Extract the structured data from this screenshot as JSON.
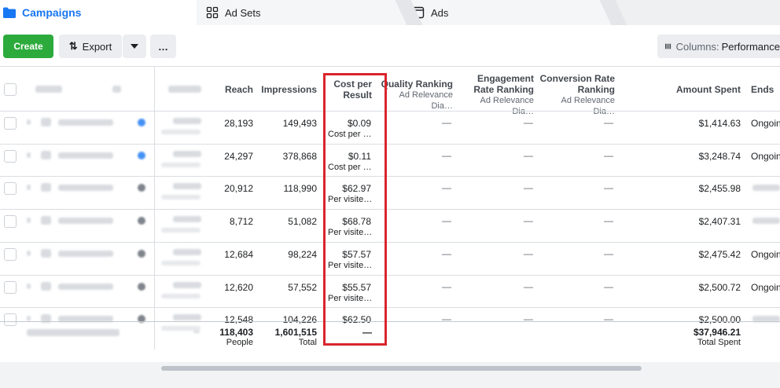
{
  "tabs": [
    {
      "label": "Campaigns",
      "icon": "folder-icon"
    },
    {
      "label": "Ad Sets",
      "icon": "grid-icon"
    },
    {
      "label": "Ads",
      "icon": "window-icon"
    }
  ],
  "toolbar": {
    "create_label": "Create",
    "export_label": "Export",
    "more_label": "…",
    "columns_label": "Columns:",
    "columns_value": "Performance"
  },
  "columns": {
    "reach": "Reach",
    "impressions": "Impressions",
    "cost_per_result": "Cost per Result",
    "quality_ranking": "Quality Ranking",
    "quality_sub": "Ad Relevance Dia…",
    "engagement_ranking": "Engagement Rate Ranking",
    "engagement_sub": "Ad Relevance Dia…",
    "conversion_ranking": "Conversion Rate Ranking",
    "conversion_sub": "Ad Relevance Dia…",
    "amount_spent": "Amount Spent",
    "ends": "Ends"
  },
  "rows": [
    {
      "reach": "28,193",
      "impressions": "149,493",
      "cpr": "$0.09",
      "cpr_sub": "Cost per …",
      "quality": "—",
      "engagement": "—",
      "conversion": "—",
      "spent": "$1,414.63",
      "ends": "Ongoin"
    },
    {
      "reach": "24,297",
      "impressions": "378,868",
      "cpr": "$0.11",
      "cpr_sub": "Cost per …",
      "quality": "—",
      "engagement": "—",
      "conversion": "—",
      "spent": "$3,248.74",
      "ends": "Ongoin"
    },
    {
      "reach": "20,912",
      "impressions": "118,990",
      "cpr": "$62.97",
      "cpr_sub": "Per visite…",
      "quality": "—",
      "engagement": "—",
      "conversion": "—",
      "spent": "$2,455.98",
      "ends": ""
    },
    {
      "reach": "8,712",
      "impressions": "51,082",
      "cpr": "$68.78",
      "cpr_sub": "Per visite…",
      "quality": "—",
      "engagement": "—",
      "conversion": "—",
      "spent": "$2,407.31",
      "ends": ""
    },
    {
      "reach": "12,684",
      "impressions": "98,224",
      "cpr": "$57.57",
      "cpr_sub": "Per visite…",
      "quality": "—",
      "engagement": "—",
      "conversion": "—",
      "spent": "$2,475.42",
      "ends": "Ongoin"
    },
    {
      "reach": "12,620",
      "impressions": "57,552",
      "cpr": "$55.57",
      "cpr_sub": "Per visite…",
      "quality": "—",
      "engagement": "—",
      "conversion": "—",
      "spent": "$2,500.72",
      "ends": "Ongoin"
    },
    {
      "reach": "12,548",
      "impressions": "104,226",
      "cpr": "$62.50",
      "cpr_sub": "",
      "quality": "—",
      "engagement": "—",
      "conversion": "—",
      "spent": "$2,500.00",
      "ends": ""
    }
  ],
  "totals": {
    "reach": "118,403",
    "reach_sub": "People",
    "impressions": "1,601,515",
    "impressions_sub": "Total",
    "cpr": "—",
    "spent": "$37,946.21",
    "spent_sub": "Total Spent"
  },
  "colors": {
    "accent": "#1877f2",
    "create": "#2cab3c",
    "highlight": "#d9252c"
  }
}
